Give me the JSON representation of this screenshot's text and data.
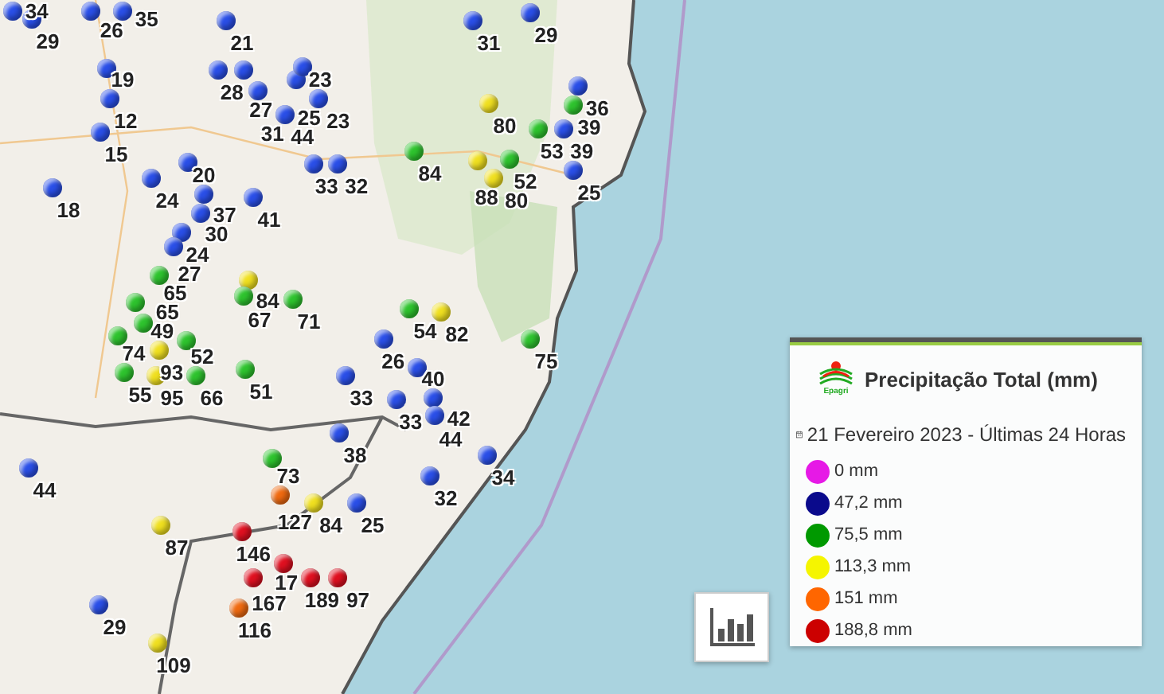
{
  "markers": [
    {
      "label": "34",
      "color": "#2a4fe8"
    },
    {
      "label": "26",
      "color": "#2a4fe8"
    },
    {
      "label": "35",
      "color": "#2a4fe8"
    },
    {
      "label": "29",
      "color": "#2a4fe8"
    },
    {
      "label": "21",
      "color": "#2a4fe8"
    },
    {
      "label": "31",
      "color": "#2a4fe8"
    },
    {
      "label": "29",
      "color": "#2a4fe8"
    },
    {
      "label": "19",
      "color": "#2a4fe8"
    },
    {
      "label": "28",
      "color": "#2a4fe8"
    },
    {
      "label": "27",
      "color": "#2a4fe8"
    },
    {
      "label": "25",
      "color": "#2a4fe8"
    },
    {
      "label": "23",
      "color": "#2a4fe8"
    },
    {
      "label": "12",
      "color": "#2a4fe8"
    },
    {
      "label": "31",
      "color": "#2a4fe8"
    },
    {
      "label": "23",
      "color": "#2a4fe8"
    },
    {
      "label": "80",
      "color": "#f0e020"
    },
    {
      "label": "36",
      "color": "#2a4fe8"
    },
    {
      "label": "39",
      "color": "#2ec42e"
    },
    {
      "label": "15",
      "color": "#2a4fe8"
    },
    {
      "label": "44",
      "color": "#2a4fe8"
    },
    {
      "label": "53",
      "color": "#2ec42e"
    },
    {
      "label": "39",
      "color": "#2a4fe8"
    },
    {
      "label": "24",
      "color": "#2a4fe8"
    },
    {
      "label": "20",
      "color": "#2a4fe8"
    },
    {
      "label": "33",
      "color": "#2a4fe8"
    },
    {
      "label": "32",
      "color": "#2a4fe8"
    },
    {
      "label": "84",
      "color": "#2ec42e"
    },
    {
      "label": "88",
      "color": "#f0e020"
    },
    {
      "label": "80",
      "color": "#f0e020"
    },
    {
      "label": "52",
      "color": "#2ec42e"
    },
    {
      "label": "25",
      "color": "#2a4fe8"
    },
    {
      "label": "18",
      "color": "#2a4fe8"
    },
    {
      "label": "37",
      "color": "#2a4fe8"
    },
    {
      "label": "41",
      "color": "#2a4fe8"
    },
    {
      "label": "30",
      "color": "#2a4fe8"
    },
    {
      "label": "24",
      "color": "#2a4fe8"
    },
    {
      "label": "27",
      "color": "#2a4fe8"
    },
    {
      "label": "65",
      "color": "#2ec42e"
    },
    {
      "label": "84",
      "color": "#f0e020"
    },
    {
      "label": "65",
      "color": "#2ec42e"
    },
    {
      "label": "67",
      "color": "#2ec42e"
    },
    {
      "label": "71",
      "color": "#2ec42e"
    },
    {
      "label": "49",
      "color": "#2ec42e"
    },
    {
      "label": "54",
      "color": "#2ec42e"
    },
    {
      "label": "82",
      "color": "#f0e020"
    },
    {
      "label": "74",
      "color": "#2ec42e"
    },
    {
      "label": "93",
      "color": "#f0e020"
    },
    {
      "label": "52",
      "color": "#2ec42e"
    },
    {
      "label": "26",
      "color": "#2a4fe8"
    },
    {
      "label": "75",
      "color": "#2ec42e"
    },
    {
      "label": "55",
      "color": "#2ec42e"
    },
    {
      "label": "95",
      "color": "#f0e020"
    },
    {
      "label": "66",
      "color": "#2ec42e"
    },
    {
      "label": "51",
      "color": "#2ec42e"
    },
    {
      "label": "33",
      "color": "#2a4fe8"
    },
    {
      "label": "40",
      "color": "#2a4fe8"
    },
    {
      "label": "33",
      "color": "#2a4fe8"
    },
    {
      "label": "42",
      "color": "#2a4fe8"
    },
    {
      "label": "44",
      "color": "#2a4fe8"
    },
    {
      "label": "38",
      "color": "#2a4fe8"
    },
    {
      "label": "44",
      "color": "#2a4fe8"
    },
    {
      "label": "73",
      "color": "#2ec42e"
    },
    {
      "label": "32",
      "color": "#2a4fe8"
    },
    {
      "label": "34",
      "color": "#2a4fe8"
    },
    {
      "label": "127",
      "color": "#f06a10"
    },
    {
      "label": "84",
      "color": "#f0e020"
    },
    {
      "label": "25",
      "color": "#2a4fe8"
    },
    {
      "label": "87",
      "color": "#f0e020"
    },
    {
      "label": "146",
      "color": "#e01020"
    },
    {
      "label": "167",
      "color": "#e01020"
    },
    {
      "label": "17",
      "color": "#e01020"
    },
    {
      "label": "189",
      "color": "#e01020"
    },
    {
      "label": "97",
      "color": "#e01020"
    },
    {
      "label": "29",
      "color": "#2a4fe8"
    },
    {
      "label": "116",
      "color": "#f06a10"
    },
    {
      "label": "109",
      "color": "#f0e020"
    }
  ],
  "legend": {
    "logo_text": "Epagri",
    "title": "Precipitação Total (mm)",
    "date": "21 Fevereiro 2023 - Últimas 24 Horas",
    "items": [
      {
        "label": "0 mm",
        "color": "#e619e6"
      },
      {
        "label": "47,2 mm",
        "color": "#0a0a8c"
      },
      {
        "label": "75,5 mm",
        "color": "#009900"
      },
      {
        "label": "113,3 mm",
        "color": "#f5f500"
      },
      {
        "label": "151 mm",
        "color": "#ff6600"
      },
      {
        "label": "188,8 mm",
        "color": "#cc0000"
      }
    ]
  }
}
